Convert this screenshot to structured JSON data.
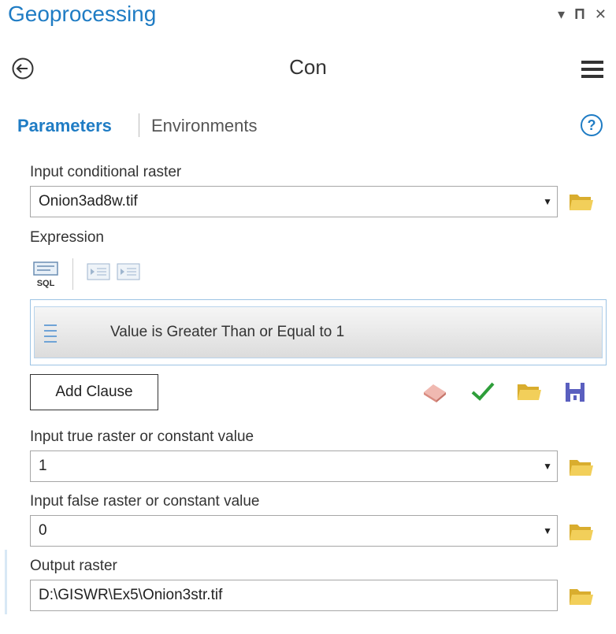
{
  "pane": {
    "title": "Geoprocessing",
    "controls": [
      "dropdown-icon",
      "pin-icon",
      "close-icon"
    ]
  },
  "tool": {
    "title": "Con"
  },
  "tabs": {
    "parameters": "Parameters",
    "environments": "Environments"
  },
  "params": {
    "conditional_raster": {
      "label": "Input conditional raster",
      "value": "Onion3ad8w.tif"
    },
    "expression": {
      "label": "Expression",
      "clause_field": "Value",
      "clause_operator": "is Greater Than or Equal to",
      "clause_value": "1",
      "add_clause_label": "Add Clause",
      "toolbar_icons": [
        "sql-icon",
        "indent-left-icon",
        "indent-right-icon"
      ],
      "action_icons": [
        "eraser-icon",
        "check-icon",
        "open-folder-icon",
        "save-icon"
      ]
    },
    "true_raster": {
      "label": "Input true raster or constant value",
      "value": "1"
    },
    "false_raster": {
      "label": "Input false raster or constant value",
      "value": "0"
    },
    "output_raster": {
      "label": "Output raster",
      "value": "D:\\GISWR\\Ex5\\Onion3str.tif"
    }
  },
  "colors": {
    "accent": "#1f7cc4",
    "folder": "#e8c24a",
    "check": "#2e9e3a",
    "save": "#5a5fbf"
  }
}
